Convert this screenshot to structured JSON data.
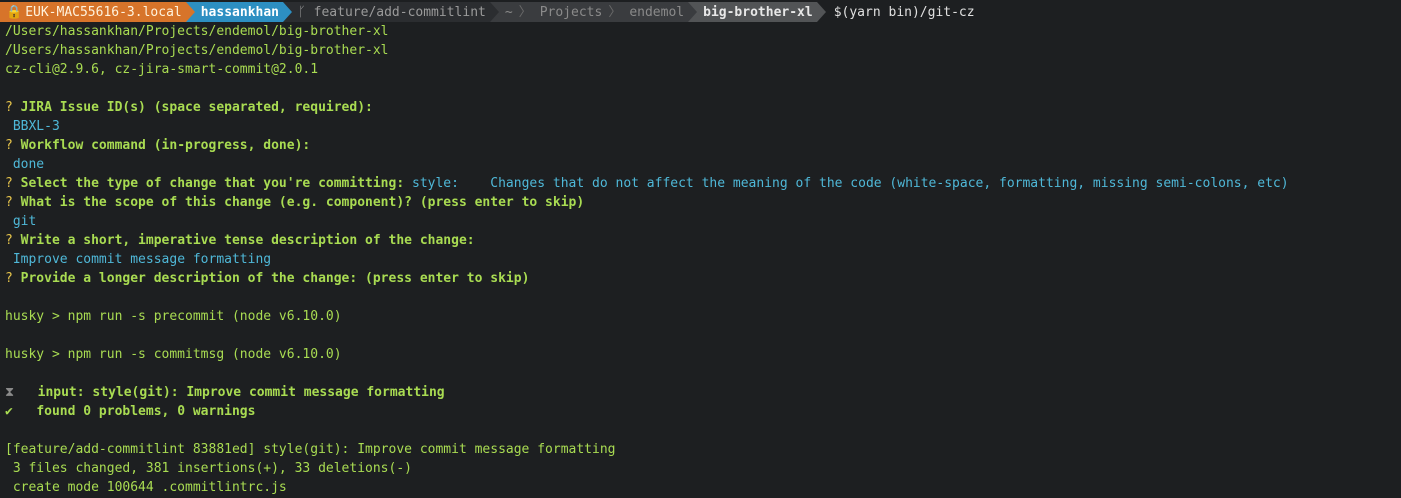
{
  "prompt": {
    "host": "EUK-MAC55616-3.local",
    "user": "hassankhan",
    "branch": "feature/add-commitlint",
    "dirs": [
      "~",
      "Projects",
      "endemol"
    ],
    "current_dir": "big-brother-xl",
    "command": "$(yarn bin)/git-cz"
  },
  "output": {
    "path1": "/Users/hassankhan/Projects/endemol/big-brother-xl",
    "path2": "/Users/hassankhan/Projects/endemol/big-brother-xl",
    "versions": "cz-cli@2.9.6, cz-jira-smart-commit@2.0.1"
  },
  "questions": [
    {
      "mark": "?",
      "text": "JIRA Issue ID(s) (space separated, required):",
      "answer": "BBXL-3"
    },
    {
      "mark": "?",
      "text": "Workflow command (in-progress, done):",
      "answer": "done"
    },
    {
      "mark": "?",
      "text": "Select the type of change that you're committing:",
      "inline_answer": "style:    Changes that do not affect the meaning of the code (white-space, formatting, missing semi-colons, etc)"
    },
    {
      "mark": "?",
      "text": "What is the scope of this change (e.g. component)? (press enter to skip)",
      "answer": "git"
    },
    {
      "mark": "?",
      "text": "Write a short, imperative tense description of the change:",
      "answer": "Improve commit message formatting"
    },
    {
      "mark": "?",
      "text": "Provide a longer description of the change: (press enter to skip)"
    }
  ],
  "husky": {
    "precommit": "husky > npm run -s precommit (node v6.10.0)",
    "commitmsg": "husky > npm run -s commitmsg (node v6.10.0)"
  },
  "commitlint": {
    "input_icon": "⧗",
    "input_label": "input:",
    "input_text": "style(git): Improve commit message formatting",
    "check_icon": "✔",
    "result_text": "found 0 problems, 0 warnings"
  },
  "git_result": {
    "summary": "[feature/add-commitlint 83881ed] style(git): Improve commit message formatting",
    "stats": " 3 files changed, 381 insertions(+), 33 deletions(-)",
    "create": " create mode 100644 .commitlintrc.js"
  },
  "colors": {
    "background": "#1d1f21",
    "green": "#a9dc52",
    "cyan": "#4fb8d8",
    "orange_segment": "#d7742a",
    "blue_segment": "#2d8fc2"
  }
}
